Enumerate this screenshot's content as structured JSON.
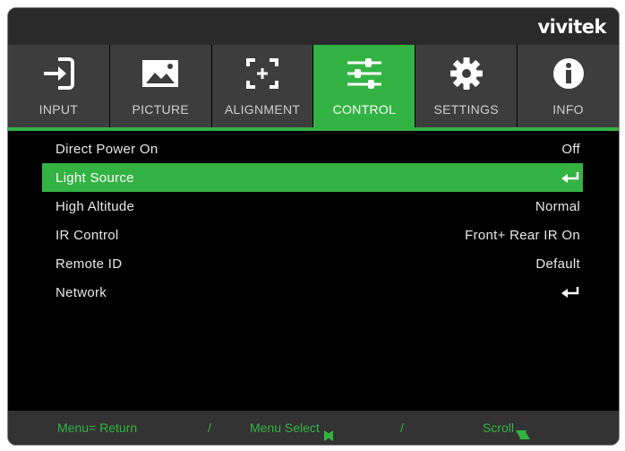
{
  "brand": {
    "logo_text": "vivitek"
  },
  "tabs": [
    {
      "label": "INPUT",
      "icon": "input-icon"
    },
    {
      "label": "PICTURE",
      "icon": "picture-icon"
    },
    {
      "label": "ALIGNMENT",
      "icon": "alignment-icon"
    },
    {
      "label": "CONTROL",
      "icon": "sliders-icon",
      "active": true
    },
    {
      "label": "SETTINGS",
      "icon": "gear-icon"
    },
    {
      "label": "INFO",
      "icon": "info-icon"
    }
  ],
  "menu": {
    "items": [
      {
        "label": "Direct Power On",
        "value": "Off"
      },
      {
        "label": "Light Source",
        "value_icon": "enter-icon",
        "selected": true
      },
      {
        "label": "High Altitude",
        "value": "Normal"
      },
      {
        "label": "IR Control",
        "value": "Front+ Rear IR On"
      },
      {
        "label": "Remote ID",
        "value": "Default"
      },
      {
        "label": "Network",
        "value_icon": "enter-icon"
      }
    ]
  },
  "footer": {
    "return_hint": "Menu= Return",
    "separator": "/",
    "select_hint": "Menu Select",
    "scroll_hint": "Scroll"
  },
  "colors": {
    "accent": "#33b343",
    "tab_bg": "#3d3d3d",
    "background": "#000000"
  }
}
